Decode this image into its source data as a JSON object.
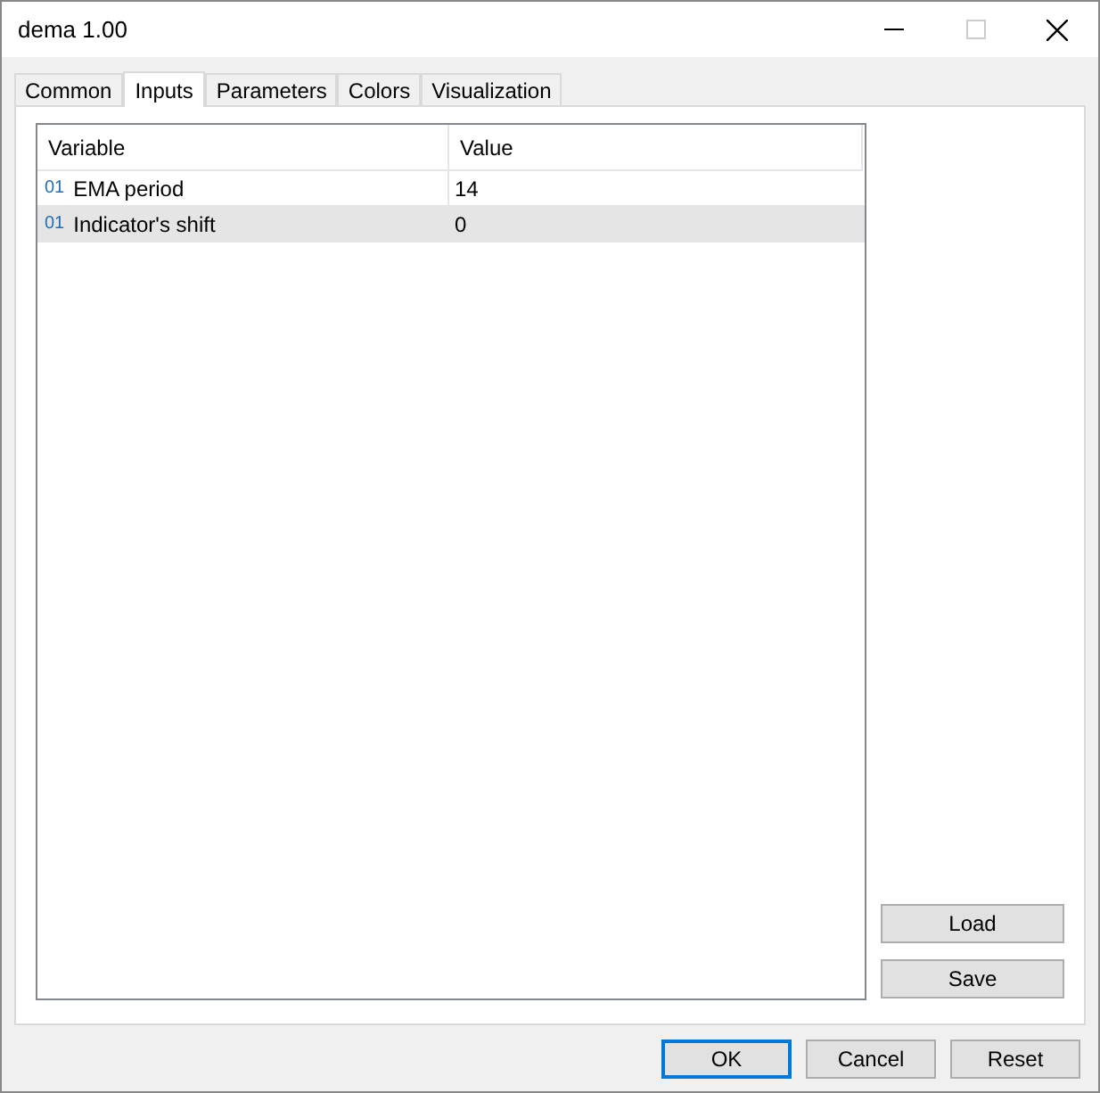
{
  "window": {
    "title": "dema 1.00"
  },
  "tabs": [
    {
      "label": "Common",
      "selected": false
    },
    {
      "label": "Inputs",
      "selected": true
    },
    {
      "label": "Parameters",
      "selected": false
    },
    {
      "label": "Colors",
      "selected": false
    },
    {
      "label": "Visualization",
      "selected": false
    }
  ],
  "table": {
    "columns": [
      "Variable",
      "Value"
    ],
    "rows": [
      {
        "type_mark": "01",
        "variable": "EMA period",
        "value": "14",
        "selected": false
      },
      {
        "type_mark": "01",
        "variable": "Indicator's shift",
        "value": "0",
        "selected": true
      }
    ]
  },
  "side_buttons": [
    "Load",
    "Save"
  ],
  "buttons": [
    {
      "label": "OK",
      "default": true
    },
    {
      "label": "Cancel",
      "default": false
    },
    {
      "label": "Reset",
      "default": false
    }
  ]
}
